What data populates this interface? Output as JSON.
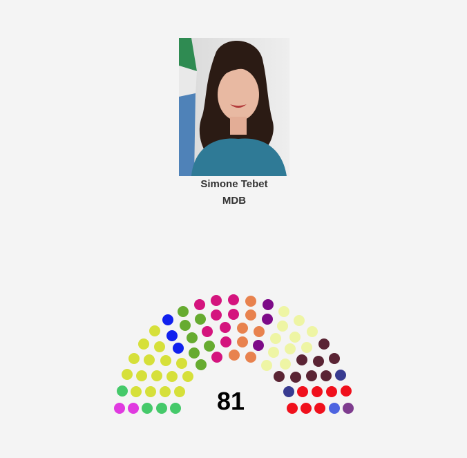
{
  "person": {
    "name": "Simone Tebet",
    "party": "MDB"
  },
  "chart_data": {
    "type": "parliament",
    "total_seats": "81",
    "group_colors": [
      "#e03ae0",
      "#45c96a",
      "#d6e03a",
      "#66ab30",
      "#1020ee",
      "#d4147e",
      "#e8824e",
      "#7d0b88",
      "#eef5a4",
      "#5a2434",
      "#383b90",
      "#f0101c",
      "#4d64e0",
      "#7e3c8e"
    ]
  }
}
